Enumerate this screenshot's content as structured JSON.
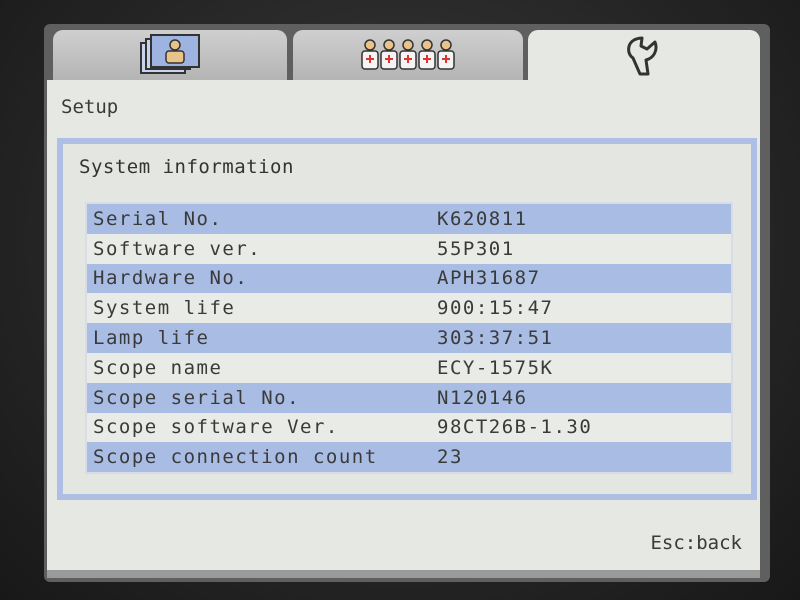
{
  "tabs": [
    {
      "icon": "patient-card-icon",
      "active": false
    },
    {
      "icon": "staff-group-icon",
      "active": false
    },
    {
      "icon": "wrench-icon",
      "active": true
    }
  ],
  "header": {
    "title": "Setup"
  },
  "system_info": {
    "title": "System information",
    "rows": [
      {
        "label": "Serial No.",
        "value": "K620811"
      },
      {
        "label": "Software ver.",
        "value": "55P301"
      },
      {
        "label": "Hardware No.",
        "value": "APH31687"
      },
      {
        "label": "System life",
        "value": "900:15:47"
      },
      {
        "label": "Lamp life",
        "value": "303:37:51"
      },
      {
        "label": "Scope name",
        "value": "ECY-1575K"
      },
      {
        "label": "Scope serial No.",
        "value": "N120146"
      },
      {
        "label": "Scope software Ver.",
        "value": "98CT26B-1.30"
      },
      {
        "label": "Scope connection count",
        "value": "23"
      }
    ]
  },
  "footer": {
    "esc_label": "Esc:back"
  },
  "colors": {
    "row_highlight": "#a9bde4",
    "frame_border": "#aebfe3",
    "panel_bg": "#e6e8e3"
  }
}
